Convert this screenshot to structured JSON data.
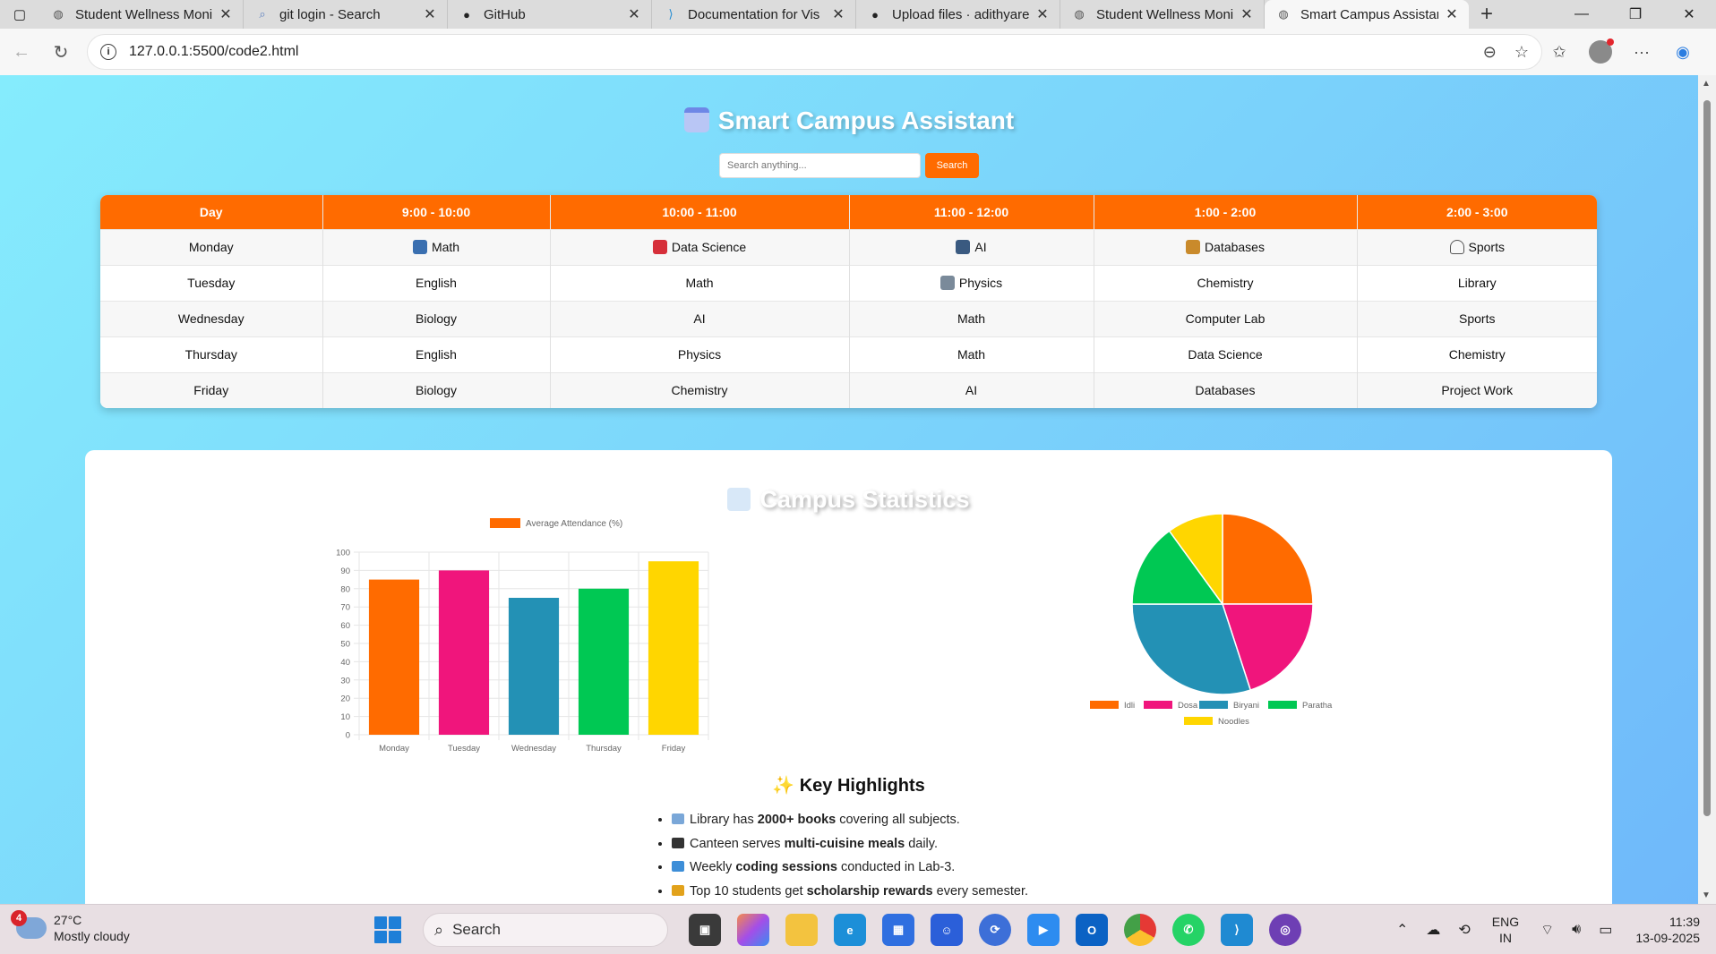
{
  "browser": {
    "tabs": [
      {
        "title": "Student Wellness Moni",
        "icon": "globe-icon",
        "active": false
      },
      {
        "title": "git login - Search",
        "icon": "search-icon",
        "active": false
      },
      {
        "title": "GitHub",
        "icon": "github-icon",
        "active": false
      },
      {
        "title": "Documentation for Vis",
        "icon": "vscode-icon",
        "active": false
      },
      {
        "title": "Upload files · adithyare",
        "icon": "github-icon",
        "active": false
      },
      {
        "title": "Student Wellness Moni",
        "icon": "globe-icon",
        "active": false
      },
      {
        "title": "Smart Campus Assistan",
        "icon": "globe-icon",
        "active": true
      }
    ],
    "url": "127.0.0.1:5500/code2.html"
  },
  "page": {
    "title": "Smart Campus Assistant",
    "search_placeholder": "Search anything...",
    "search_button": "Search",
    "timetable": {
      "headers": [
        "Day",
        "9:00 - 10:00",
        "10:00 - 11:00",
        "11:00 - 12:00",
        "1:00 - 2:00",
        "2:00 - 3:00"
      ],
      "rows": [
        [
          "Monday",
          "Math",
          "Data Science",
          "AI",
          "Databases",
          "Sports"
        ],
        [
          "Tuesday",
          "English",
          "Math",
          "Physics",
          "Chemistry",
          "Library"
        ],
        [
          "Wednesday",
          "Biology",
          "AI",
          "Math",
          "Computer Lab",
          "Sports"
        ],
        [
          "Thursday",
          "English",
          "Physics",
          "Math",
          "Data Science",
          "Chemistry"
        ],
        [
          "Friday",
          "Biology",
          "Chemistry",
          "AI",
          "Databases",
          "Project Work"
        ]
      ]
    },
    "stats_title": "Campus Statistics",
    "highlights_title": "Key Highlights",
    "highlights": [
      {
        "pre": "Library has ",
        "bold": "2000+ books",
        "post": " covering all subjects.",
        "icon": "book-icon"
      },
      {
        "pre": "Canteen serves ",
        "bold": "multi-cuisine meals",
        "post": " daily.",
        "icon": "plate-icon"
      },
      {
        "pre": "Weekly ",
        "bold": "coding sessions",
        "post": " conducted in Lab-3.",
        "icon": "laptop-icon"
      },
      {
        "pre": "Top 10 students get ",
        "bold": "scholarship rewards",
        "post": " every semester.",
        "icon": "trophy-icon"
      }
    ]
  },
  "chart_data": [
    {
      "type": "bar",
      "categories": [
        "Monday",
        "Tuesday",
        "Wednesday",
        "Thursday",
        "Friday"
      ],
      "series": [
        {
          "name": "Average Attendance (%)",
          "values": [
            85,
            90,
            75,
            80,
            95
          ]
        }
      ],
      "colors": [
        "#ff6b00",
        "#f0157c",
        "#2391b5",
        "#00c853",
        "#ffd600"
      ],
      "ylim": [
        0,
        100
      ],
      "yticks": [
        0,
        10,
        20,
        30,
        40,
        50,
        60,
        70,
        80,
        90,
        100
      ],
      "legend": "top",
      "grid": true
    },
    {
      "type": "pie",
      "labels": [
        "Idli",
        "Dosa",
        "Biryani",
        "Paratha",
        "Noodles"
      ],
      "values": [
        25,
        20,
        30,
        15,
        10
      ],
      "colors": [
        "#ff6b00",
        "#f0157c",
        "#2391b5",
        "#00c853",
        "#ffd600"
      ],
      "legend": "bottom"
    }
  ],
  "taskbar": {
    "weather_temp": "27°C",
    "weather_desc": "Mostly cloudy",
    "weather_badge": "4",
    "search_label": "Search",
    "lang_line1": "ENG",
    "lang_line2": "IN",
    "time": "11:39",
    "date": "13-09-2025"
  }
}
